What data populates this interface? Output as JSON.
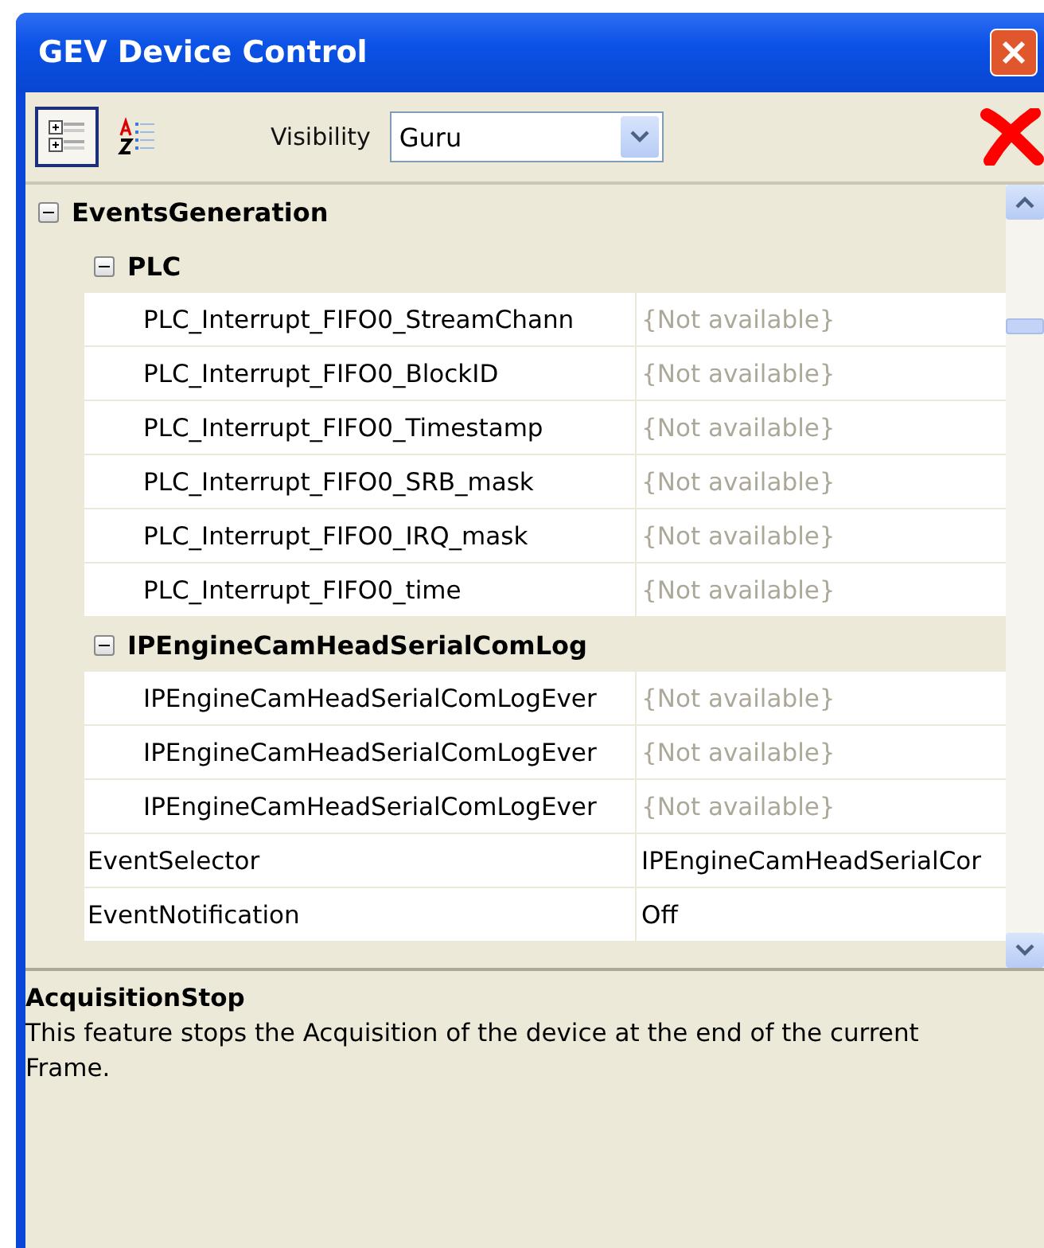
{
  "window": {
    "title": "GEV Device Control"
  },
  "toolbar": {
    "views": [
      {
        "kind": "categorized",
        "selected": true
      },
      {
        "kind": "alphabetical",
        "selected": false
      }
    ],
    "visibility_label": "Visibility",
    "visibility_value": "Guru"
  },
  "tree": [
    {
      "kind": "category",
      "label": "EventsGeneration",
      "expanded": true,
      "children": [
        {
          "kind": "category",
          "label": "PLC",
          "expanded": true,
          "children": [
            {
              "kind": "property",
              "name": "PLC_Interrupt_FIFO0_StreamChann",
              "value": "{Not available}",
              "disabled": true
            },
            {
              "kind": "property",
              "name": "PLC_Interrupt_FIFO0_BlockID",
              "value": "{Not available}",
              "disabled": true
            },
            {
              "kind": "property",
              "name": "PLC_Interrupt_FIFO0_Timestamp",
              "value": "{Not available}",
              "disabled": true
            },
            {
              "kind": "property",
              "name": "PLC_Interrupt_FIFO0_SRB_mask",
              "value": "{Not available}",
              "disabled": true
            },
            {
              "kind": "property",
              "name": "PLC_Interrupt_FIFO0_IRQ_mask",
              "value": "{Not available}",
              "disabled": true
            },
            {
              "kind": "property",
              "name": "PLC_Interrupt_FIFO0_time",
              "value": "{Not available}",
              "disabled": true
            }
          ]
        },
        {
          "kind": "category",
          "label": "IPEngineCamHeadSerialComLog",
          "expanded": true,
          "children": [
            {
              "kind": "property",
              "name": "IPEngineCamHeadSerialComLogEver",
              "value": "{Not available}",
              "disabled": true
            },
            {
              "kind": "property",
              "name": "IPEngineCamHeadSerialComLogEver",
              "value": "{Not available}",
              "disabled": true
            },
            {
              "kind": "property",
              "name": "IPEngineCamHeadSerialComLogEver",
              "value": "{Not available}",
              "disabled": true
            }
          ]
        },
        {
          "kind": "property",
          "name": "EventSelector",
          "value": "IPEngineCamHeadSerialCor",
          "disabled": false
        },
        {
          "kind": "property",
          "name": "EventNotification",
          "value": "Off",
          "disabled": false
        }
      ]
    }
  ],
  "description": {
    "title": "AcquisitionStop",
    "text": "This feature stops the Acquisition of the device at the end of the current Frame."
  }
}
